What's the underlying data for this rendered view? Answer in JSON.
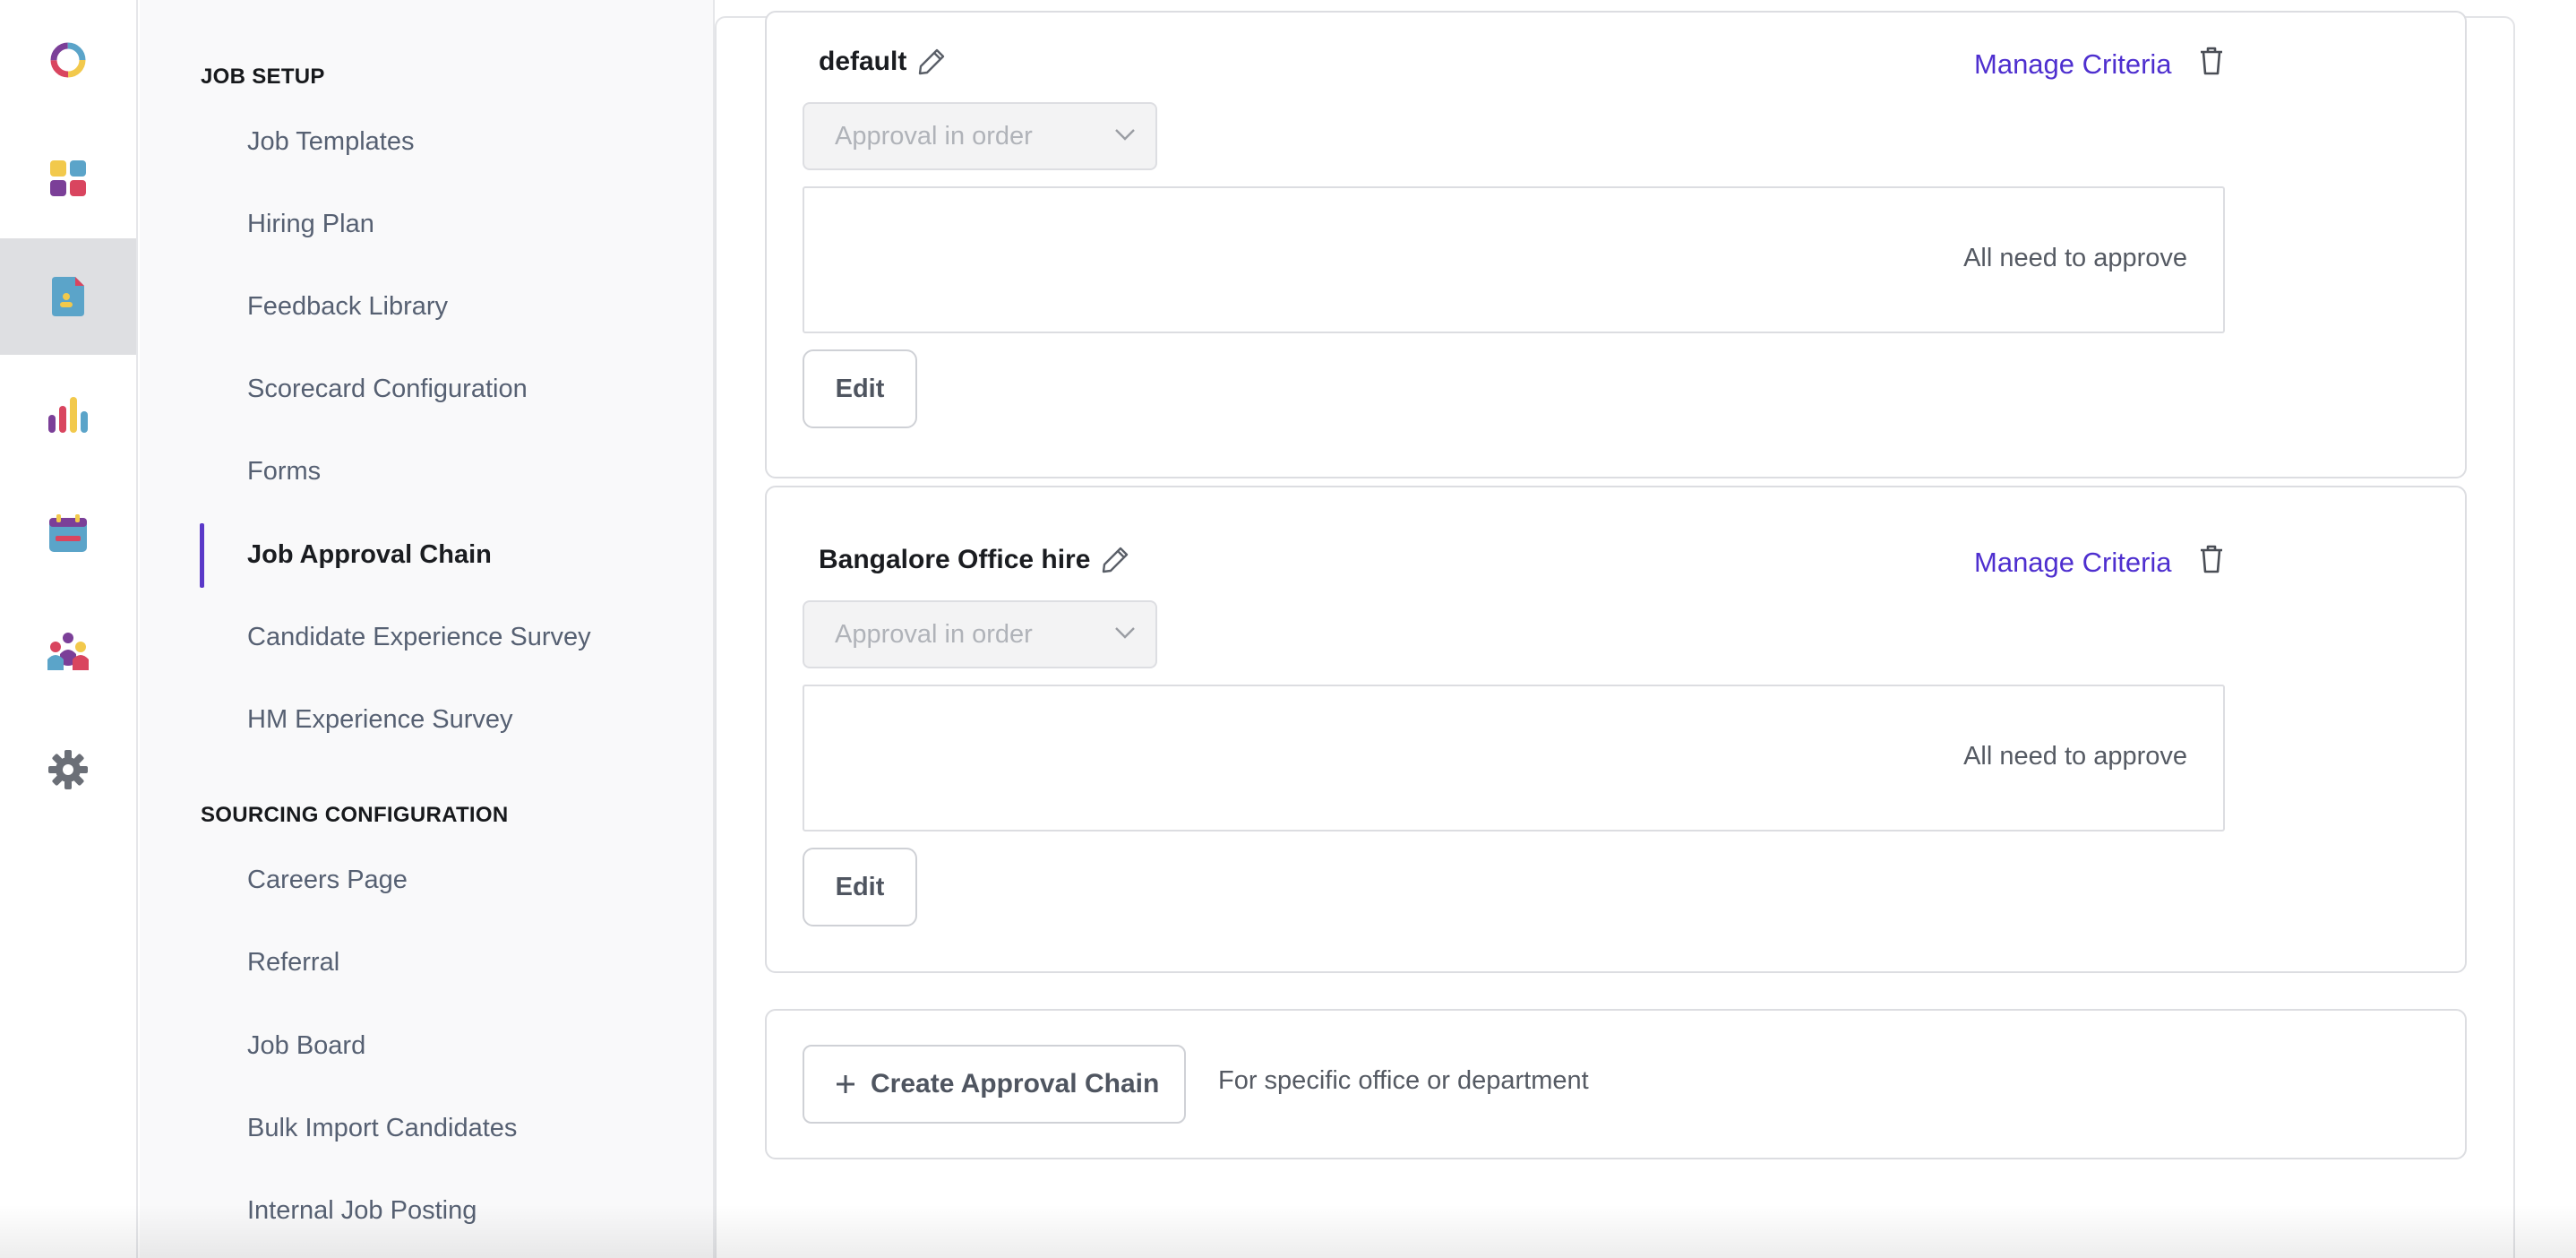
{
  "rail": {
    "items": [
      {
        "icon": "logo-ring-icon"
      },
      {
        "icon": "dashboard-grid-icon"
      },
      {
        "icon": "jobs-document-icon",
        "active": true
      },
      {
        "icon": "reports-bar-chart-icon"
      },
      {
        "icon": "calendar-icon"
      },
      {
        "icon": "team-people-icon"
      },
      {
        "icon": "settings-gear-icon"
      }
    ]
  },
  "subnav": {
    "job_setup": {
      "title": "JOB SETUP",
      "items": [
        {
          "label": "Job Templates"
        },
        {
          "label": "Hiring Plan"
        },
        {
          "label": "Feedback Library"
        },
        {
          "label": "Scorecard Configuration"
        },
        {
          "label": "Forms"
        },
        {
          "label": "Job Approval Chain",
          "active": true
        },
        {
          "label": "Candidate Experience Survey"
        },
        {
          "label": "HM Experience Survey"
        }
      ]
    },
    "sourcing": {
      "title": "SOURCING CONFIGURATION",
      "items": [
        {
          "label": "Careers Page"
        },
        {
          "label": "Referral"
        },
        {
          "label": "Job Board"
        },
        {
          "label": "Bulk Import Candidates"
        },
        {
          "label": "Internal Job Posting"
        }
      ]
    }
  },
  "chains": [
    {
      "name": "default",
      "manage_label": "Manage Criteria",
      "approval_mode": "Approval in order",
      "rule_text": "All need to approve",
      "edit_label": "Edit"
    },
    {
      "name": "Bangalore Office hire",
      "manage_label": "Manage Criteria",
      "approval_mode": "Approval in order",
      "rule_text": "All need to approve",
      "edit_label": "Edit"
    }
  ],
  "create": {
    "button_label": "Create Approval Chain",
    "hint": "For specific office or department"
  },
  "colors": {
    "accent": "#5b39c8",
    "link": "#4e2fcf"
  }
}
